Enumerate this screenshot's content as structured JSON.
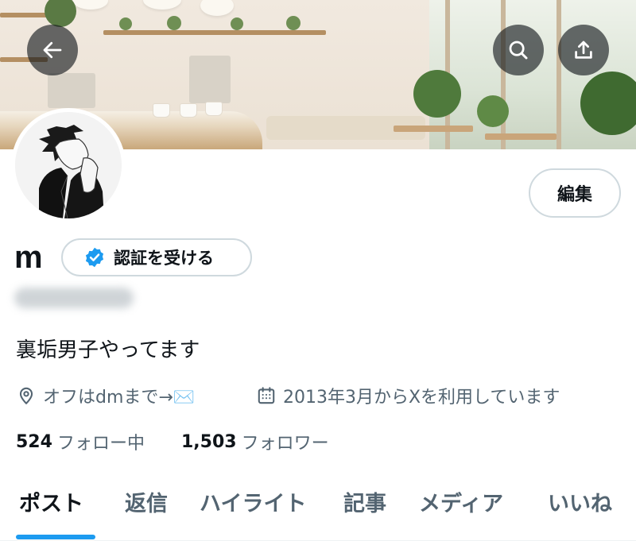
{
  "header": {
    "back_icon": "arrow-left-icon",
    "search_icon": "search-icon",
    "share_icon": "share-upload-icon"
  },
  "profile": {
    "display_name": "m",
    "verify_label": "認証を受ける",
    "edit_label": "編集",
    "bio": "裏垢男子やってます",
    "location": "オフはdmまで→✉️",
    "joined": "2013年3月からXを利用しています",
    "following_count": "524",
    "following_label": "フォロー中",
    "followers_count": "1,503",
    "followers_label": "フォロワー"
  },
  "tabs": [
    {
      "label": "ポスト",
      "active": true
    },
    {
      "label": "返信",
      "active": false
    },
    {
      "label": "ハイライト",
      "active": false
    },
    {
      "label": "記事",
      "active": false
    },
    {
      "label": "メディア",
      "active": false
    },
    {
      "label": "いいね",
      "active": false
    }
  ],
  "colors": {
    "accent": "#1d9bf0",
    "text": "#0f1419",
    "secondary_text": "#536471",
    "border": "#cfd9de"
  }
}
